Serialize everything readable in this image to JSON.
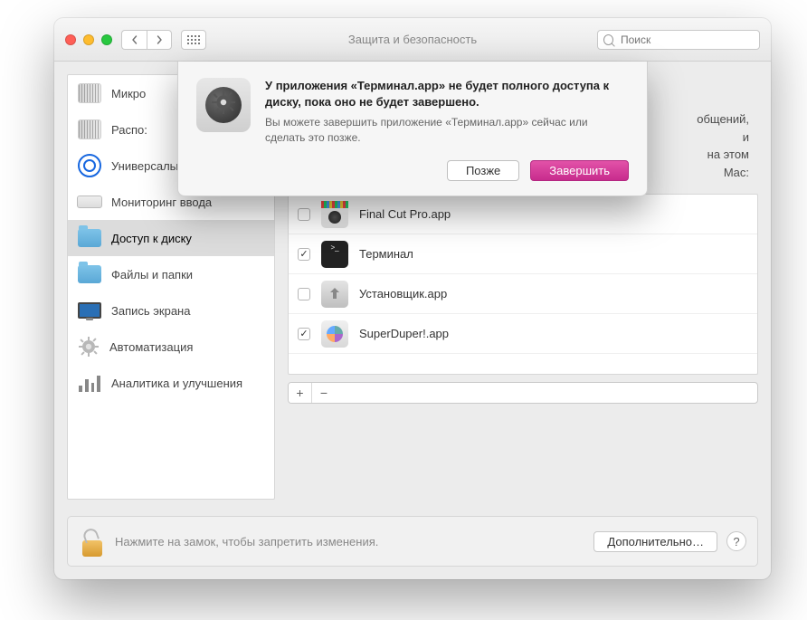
{
  "window": {
    "title": "Защита и безопасность",
    "search_placeholder": "Поиск"
  },
  "sidebar": {
    "items": [
      {
        "id": "microphone",
        "label": "Микро"
      },
      {
        "id": "speech",
        "label": "Распо:"
      },
      {
        "id": "accessibility",
        "label": "Универсальный доступ"
      },
      {
        "id": "input-monitoring",
        "label": "Мониторинг ввода"
      },
      {
        "id": "full-disk-access",
        "label": "Доступ к диску",
        "selected": true
      },
      {
        "id": "files-and-folders",
        "label": "Файлы и папки"
      },
      {
        "id": "screen-recording",
        "label": "Запись экрана"
      },
      {
        "id": "automation",
        "label": "Автоматизация"
      },
      {
        "id": "analytics",
        "label": "Аналитика и улучшения"
      }
    ]
  },
  "main": {
    "description_tail": "общений,\nи\nна этом\nMac:",
    "apps": [
      {
        "name": "Final Cut Pro.app",
        "checked": false
      },
      {
        "name": "Терминал",
        "checked": true
      },
      {
        "name": "Установщик.app",
        "checked": false
      },
      {
        "name": "SuperDuper!.app",
        "checked": true
      }
    ]
  },
  "footer": {
    "lock_hint": "Нажмите на замок, чтобы запретить изменения.",
    "advanced": "Дополнительно…",
    "help": "?"
  },
  "sheet": {
    "headline": "У приложения «Терминал.app» не будет полного доступа к диску, пока оно не будет завершено.",
    "sub": "Вы можете завершить приложение «Терминал.app» сейчас или сделать это позже.",
    "later": "Позже",
    "quit": "Завершить"
  }
}
